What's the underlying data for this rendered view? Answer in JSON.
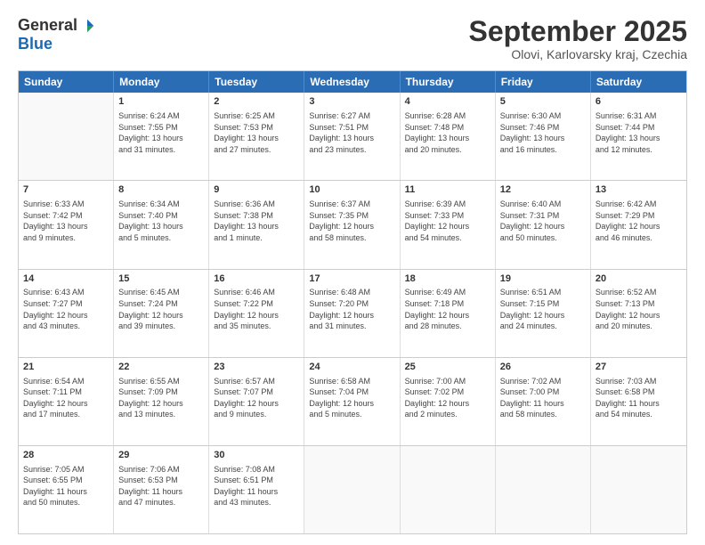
{
  "logo": {
    "general": "General",
    "blue": "Blue"
  },
  "title": "September 2025",
  "location": "Olovi, Karlovarsky kraj, Czechia",
  "days_of_week": [
    "Sunday",
    "Monday",
    "Tuesday",
    "Wednesday",
    "Thursday",
    "Friday",
    "Saturday"
  ],
  "weeks": [
    [
      {
        "day": "",
        "info": ""
      },
      {
        "day": "1",
        "info": "Sunrise: 6:24 AM\nSunset: 7:55 PM\nDaylight: 13 hours\nand 31 minutes."
      },
      {
        "day": "2",
        "info": "Sunrise: 6:25 AM\nSunset: 7:53 PM\nDaylight: 13 hours\nand 27 minutes."
      },
      {
        "day": "3",
        "info": "Sunrise: 6:27 AM\nSunset: 7:51 PM\nDaylight: 13 hours\nand 23 minutes."
      },
      {
        "day": "4",
        "info": "Sunrise: 6:28 AM\nSunset: 7:48 PM\nDaylight: 13 hours\nand 20 minutes."
      },
      {
        "day": "5",
        "info": "Sunrise: 6:30 AM\nSunset: 7:46 PM\nDaylight: 13 hours\nand 16 minutes."
      },
      {
        "day": "6",
        "info": "Sunrise: 6:31 AM\nSunset: 7:44 PM\nDaylight: 13 hours\nand 12 minutes."
      }
    ],
    [
      {
        "day": "7",
        "info": "Sunrise: 6:33 AM\nSunset: 7:42 PM\nDaylight: 13 hours\nand 9 minutes."
      },
      {
        "day": "8",
        "info": "Sunrise: 6:34 AM\nSunset: 7:40 PM\nDaylight: 13 hours\nand 5 minutes."
      },
      {
        "day": "9",
        "info": "Sunrise: 6:36 AM\nSunset: 7:38 PM\nDaylight: 13 hours\nand 1 minute."
      },
      {
        "day": "10",
        "info": "Sunrise: 6:37 AM\nSunset: 7:35 PM\nDaylight: 12 hours\nand 58 minutes."
      },
      {
        "day": "11",
        "info": "Sunrise: 6:39 AM\nSunset: 7:33 PM\nDaylight: 12 hours\nand 54 minutes."
      },
      {
        "day": "12",
        "info": "Sunrise: 6:40 AM\nSunset: 7:31 PM\nDaylight: 12 hours\nand 50 minutes."
      },
      {
        "day": "13",
        "info": "Sunrise: 6:42 AM\nSunset: 7:29 PM\nDaylight: 12 hours\nand 46 minutes."
      }
    ],
    [
      {
        "day": "14",
        "info": "Sunrise: 6:43 AM\nSunset: 7:27 PM\nDaylight: 12 hours\nand 43 minutes."
      },
      {
        "day": "15",
        "info": "Sunrise: 6:45 AM\nSunset: 7:24 PM\nDaylight: 12 hours\nand 39 minutes."
      },
      {
        "day": "16",
        "info": "Sunrise: 6:46 AM\nSunset: 7:22 PM\nDaylight: 12 hours\nand 35 minutes."
      },
      {
        "day": "17",
        "info": "Sunrise: 6:48 AM\nSunset: 7:20 PM\nDaylight: 12 hours\nand 31 minutes."
      },
      {
        "day": "18",
        "info": "Sunrise: 6:49 AM\nSunset: 7:18 PM\nDaylight: 12 hours\nand 28 minutes."
      },
      {
        "day": "19",
        "info": "Sunrise: 6:51 AM\nSunset: 7:15 PM\nDaylight: 12 hours\nand 24 minutes."
      },
      {
        "day": "20",
        "info": "Sunrise: 6:52 AM\nSunset: 7:13 PM\nDaylight: 12 hours\nand 20 minutes."
      }
    ],
    [
      {
        "day": "21",
        "info": "Sunrise: 6:54 AM\nSunset: 7:11 PM\nDaylight: 12 hours\nand 17 minutes."
      },
      {
        "day": "22",
        "info": "Sunrise: 6:55 AM\nSunset: 7:09 PM\nDaylight: 12 hours\nand 13 minutes."
      },
      {
        "day": "23",
        "info": "Sunrise: 6:57 AM\nSunset: 7:07 PM\nDaylight: 12 hours\nand 9 minutes."
      },
      {
        "day": "24",
        "info": "Sunrise: 6:58 AM\nSunset: 7:04 PM\nDaylight: 12 hours\nand 5 minutes."
      },
      {
        "day": "25",
        "info": "Sunrise: 7:00 AM\nSunset: 7:02 PM\nDaylight: 12 hours\nand 2 minutes."
      },
      {
        "day": "26",
        "info": "Sunrise: 7:02 AM\nSunset: 7:00 PM\nDaylight: 11 hours\nand 58 minutes."
      },
      {
        "day": "27",
        "info": "Sunrise: 7:03 AM\nSunset: 6:58 PM\nDaylight: 11 hours\nand 54 minutes."
      }
    ],
    [
      {
        "day": "28",
        "info": "Sunrise: 7:05 AM\nSunset: 6:55 PM\nDaylight: 11 hours\nand 50 minutes."
      },
      {
        "day": "29",
        "info": "Sunrise: 7:06 AM\nSunset: 6:53 PM\nDaylight: 11 hours\nand 47 minutes."
      },
      {
        "day": "30",
        "info": "Sunrise: 7:08 AM\nSunset: 6:51 PM\nDaylight: 11 hours\nand 43 minutes."
      },
      {
        "day": "",
        "info": ""
      },
      {
        "day": "",
        "info": ""
      },
      {
        "day": "",
        "info": ""
      },
      {
        "day": "",
        "info": ""
      }
    ]
  ]
}
